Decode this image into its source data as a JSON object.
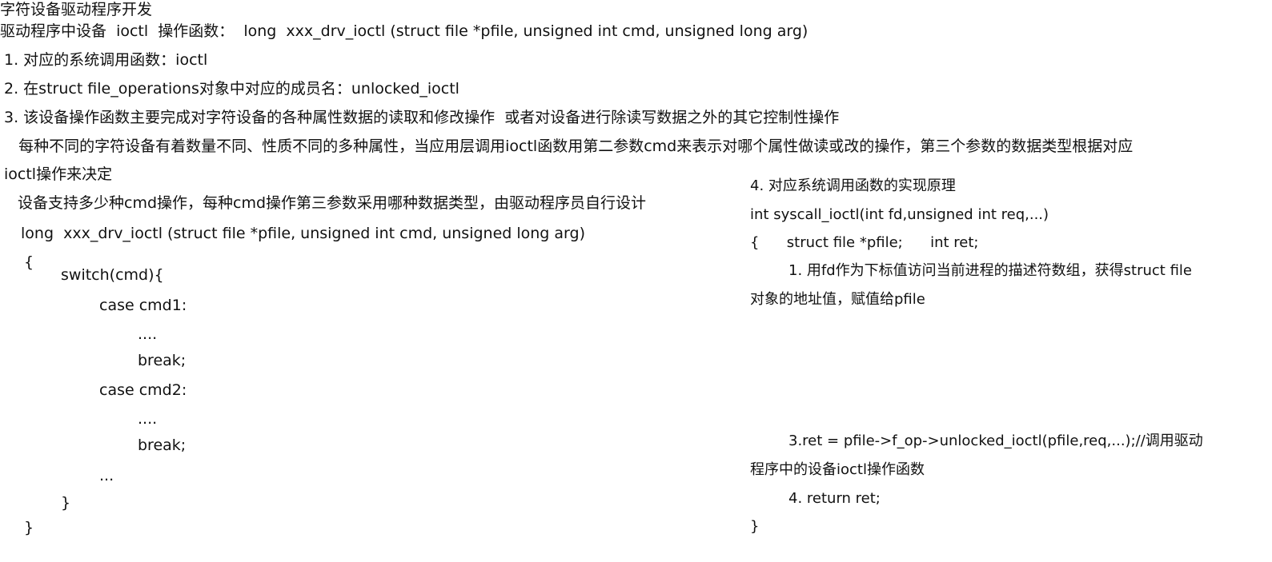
{
  "left": {
    "title": "字符设备驱动程序开发",
    "subtitle": "驱动程序中设备  ioctl  操作函数：  long  xxx_drv_ioctl (struct file *pfile, unsigned int cmd, unsigned long arg)",
    "item1": "1. 对应的系统调用函数：ioctl",
    "item2": "2. 在struct file_operations对象中对应的成员名：unlocked_ioctl",
    "item3": "3. 该设备操作函数主要完成对字符设备的各种属性数据的读取和修改操作  或者对设备进行除读写数据之外的其它控制性操作",
    "para1": "   每种不同的字符设备有着数量不同、性质不同的多种属性，当应用层调用ioctl函数用第二参数cmd来表示对哪个属性做读或改的操作，第三个参数的数据类型根据对应",
    "para1_cont": "ioctl操作来决定",
    "para2": "设备支持多少种cmd操作，每种cmd操作第三参数采用哪种数据类型，由驱动程序员自行设计",
    "code": {
      "sig": "long  xxx_drv_ioctl (struct file *pfile, unsigned int cmd, unsigned long arg)",
      "open_brace": "{",
      "switch": "switch(cmd){",
      "case1": "case cmd1:",
      "dots1": "....",
      "break1": "break;",
      "case2": "case cmd2:",
      "dots2": "....",
      "break2": "break;",
      "dots3": "...",
      "switch_close": "}",
      "close_brace": "}"
    }
  },
  "right": {
    "heading": "4. 对应系统调用函数的实现原理",
    "sig": "int syscall_ioctl(int fd,unsigned int req,...)",
    "decl": "{      struct file *pfile;      int ret;",
    "step1": "1. 用fd作为下标值访问当前进程的描述符数组，获得struct file",
    "step1_cont": "对象的地址值，赋值给pfile",
    "step3": "3.ret = pfile->f_op->unlocked_ioctl(pfile,req,...);//调用驱动",
    "step3_cont": "程序中的设备ioctl操作函数",
    "step4": "4. return ret;",
    "close_brace": "}"
  }
}
